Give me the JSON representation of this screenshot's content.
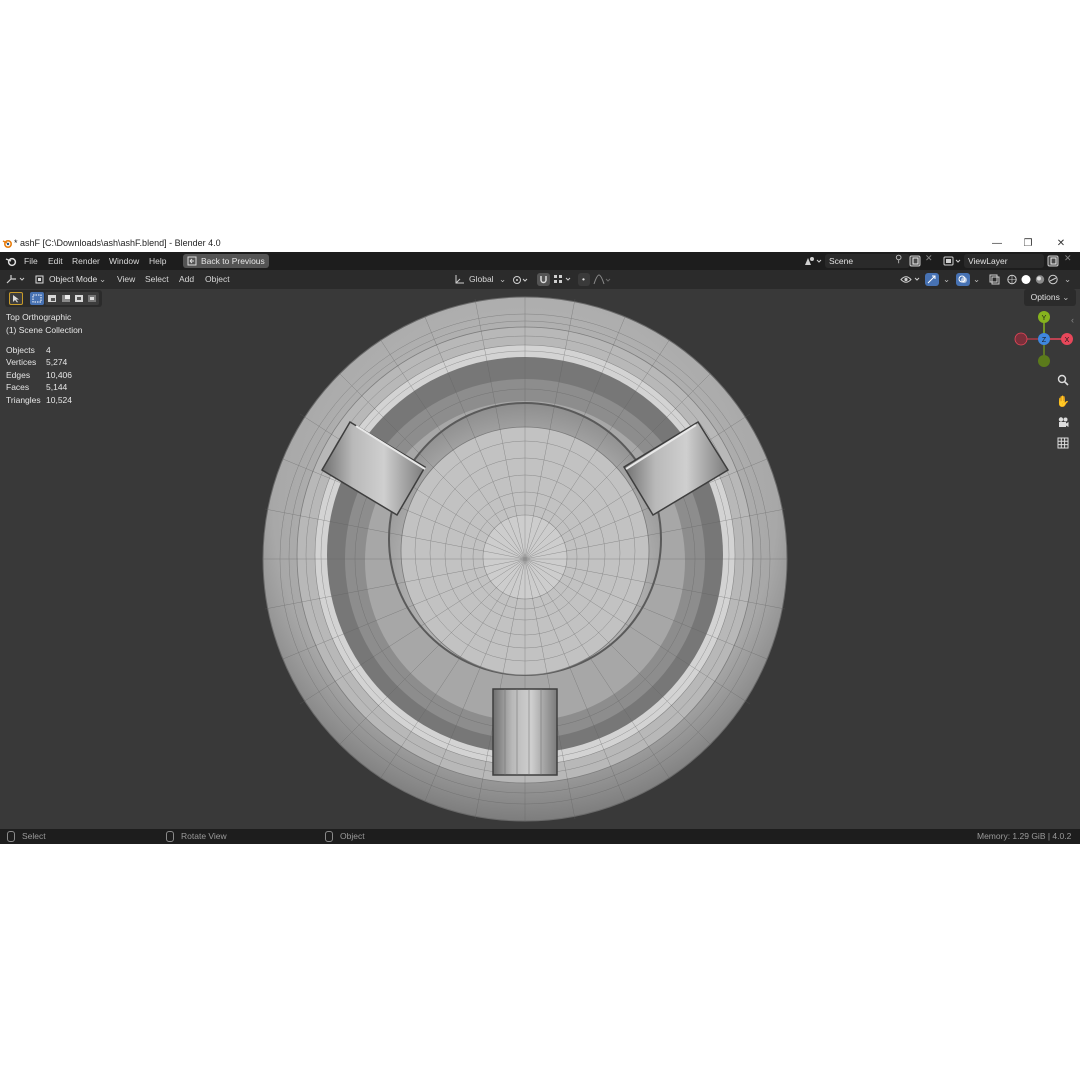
{
  "window": {
    "title": "* ashF [C:\\Downloads\\ash\\ashF.blend] - Blender 4.0",
    "controls": {
      "minimize": "—",
      "restore": "❐",
      "close": "✕"
    }
  },
  "menubar": {
    "menus": [
      "File",
      "Edit",
      "Render",
      "Window",
      "Help"
    ],
    "back_button": "Back to Previous",
    "scene_name": "Scene",
    "view_layer": "ViewLayer"
  },
  "header": {
    "mode": "Object Mode",
    "menus": [
      "View",
      "Select",
      "Add",
      "Object"
    ],
    "transform_orientation": "Global",
    "options_label": "Options"
  },
  "viewport": {
    "view_name": "Top Orthographic",
    "collection": "(1) Scene Collection",
    "stats": [
      {
        "label": "Objects",
        "value": "4"
      },
      {
        "label": "Vertices",
        "value": "5,274"
      },
      {
        "label": "Edges",
        "value": "10,406"
      },
      {
        "label": "Faces",
        "value": "5,144"
      },
      {
        "label": "Triangles",
        "value": "10,524"
      }
    ],
    "gizmo": {
      "y": "Y",
      "z": "Z",
      "x": "X"
    },
    "colors": {
      "x_axis": "#e8475a",
      "y_axis": "#86b31e",
      "z_axis": "#3f87de",
      "background": "#393939"
    }
  },
  "statusbar": {
    "select": "Select",
    "rotate": "Rotate View",
    "object": "Object",
    "memory": "Memory: 1.29 GiB | 4.0.2"
  }
}
